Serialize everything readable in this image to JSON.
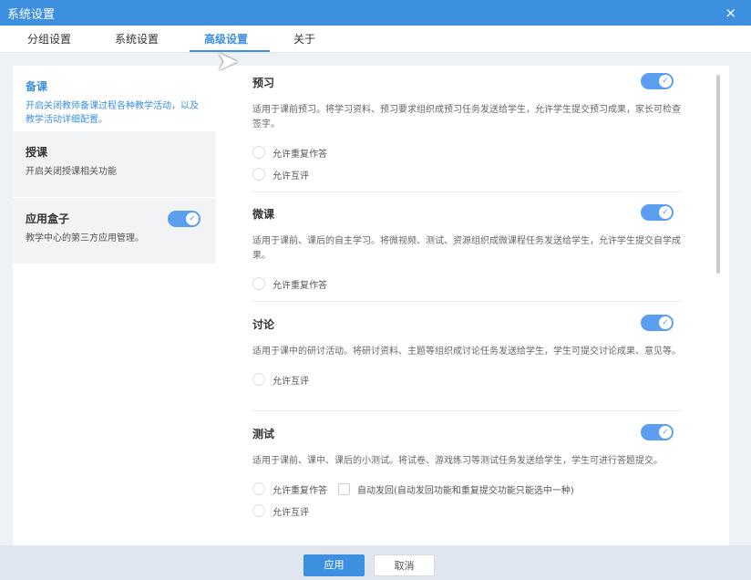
{
  "window": {
    "title": "系统设置",
    "close": "×"
  },
  "tabs": [
    "分组设置",
    "系统设置",
    "高级设置",
    "关于"
  ],
  "active_tab": "高级设置",
  "left": [
    {
      "title": "备课",
      "desc": "开启关闭教师备课过程各种教学活动，以及教学活动详细配置。",
      "selected": true
    },
    {
      "title": "授课",
      "desc": "开启关闭授课相关功能"
    },
    {
      "title": "应用盒子",
      "desc": "教学中心的第三方应用管理。",
      "toggle": true
    }
  ],
  "sections": [
    {
      "title": "预习",
      "enabled": true,
      "desc": "适用于课前预习。将学习资料、预习要求组织成预习任务发送给学生，允许学生提交预习成果，家长可检查签字。",
      "options": [
        "允许重复作答",
        "允许互评"
      ]
    },
    {
      "title": "微课",
      "enabled": true,
      "desc": "适用于课前、课后的自主学习。将微视频、测试、资源组织成微课程任务发送给学生，允许学生提交自学成果。",
      "options": [
        "允许重复作答"
      ]
    },
    {
      "title": "讨论",
      "enabled": true,
      "desc": "适用于课中的研讨活动。将研讨资料、主题等组织成讨论任务发送给学生，学生可提交讨论成果、意见等。",
      "options": [
        "允许互评"
      ]
    },
    {
      "title": "测试",
      "enabled": true,
      "desc": "适用于课前、课中、课后的小测试。将试卷、游戏练习等测试任务发送给学生，学生可进行答题提交。",
      "options": [
        "允许重复作答",
        "允许互评"
      ],
      "checkbox": "自动发回(自动发回功能和重复提交功能只能选中一种)"
    }
  ],
  "footer": {
    "apply": "应用",
    "cancel": "取消"
  }
}
